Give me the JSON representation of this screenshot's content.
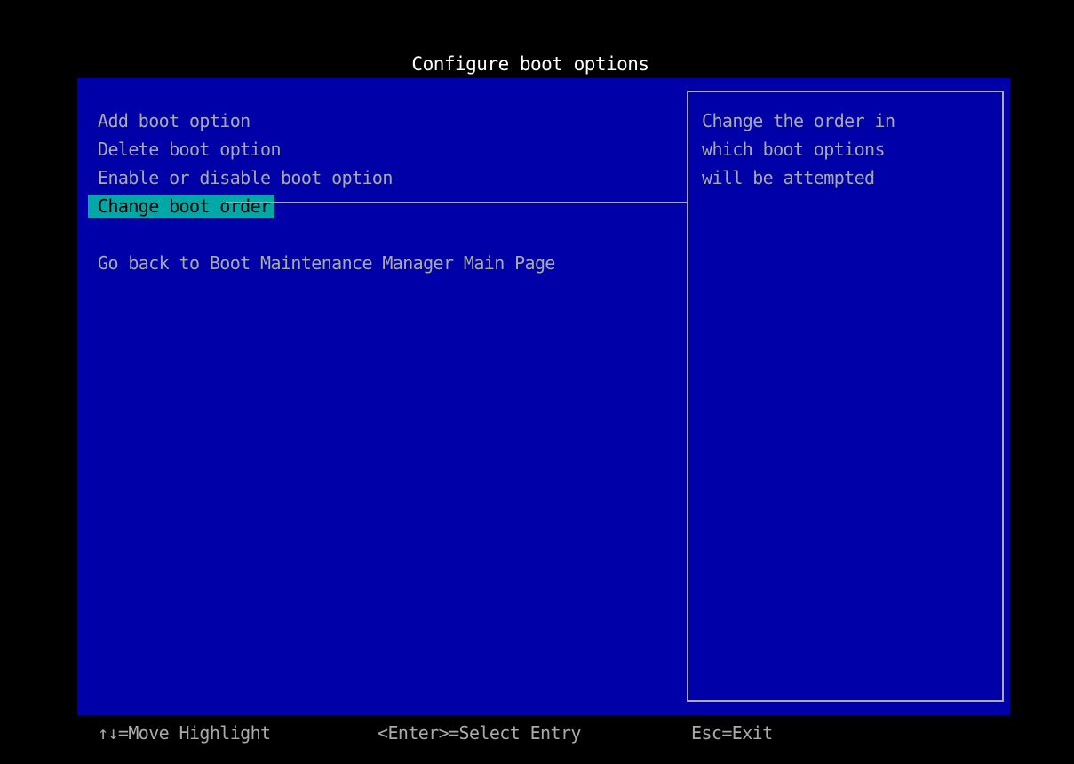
{
  "screen": {
    "title": "Configure boot options"
  },
  "menu": {
    "items": [
      {
        "label": "Add boot option"
      },
      {
        "label": "Delete boot option"
      },
      {
        "label": "Enable or disable boot option"
      },
      {
        "label": "Change boot order",
        "selected": true
      },
      {
        "label": "Go back to Boot Maintenance Manager Main Page"
      }
    ]
  },
  "help": {
    "lines": [
      "Change the order in",
      "which boot options",
      "will be attempted"
    ]
  },
  "footer": {
    "move": "↑↓=Move Highlight",
    "select": "<Enter>=Select Entry",
    "exit": "Esc=Exit"
  },
  "colors": {
    "background": "#000000",
    "panel": "#0000a8",
    "text": "#aaaaaa",
    "highlight": "#00a8a8",
    "title": "#ffffff"
  }
}
